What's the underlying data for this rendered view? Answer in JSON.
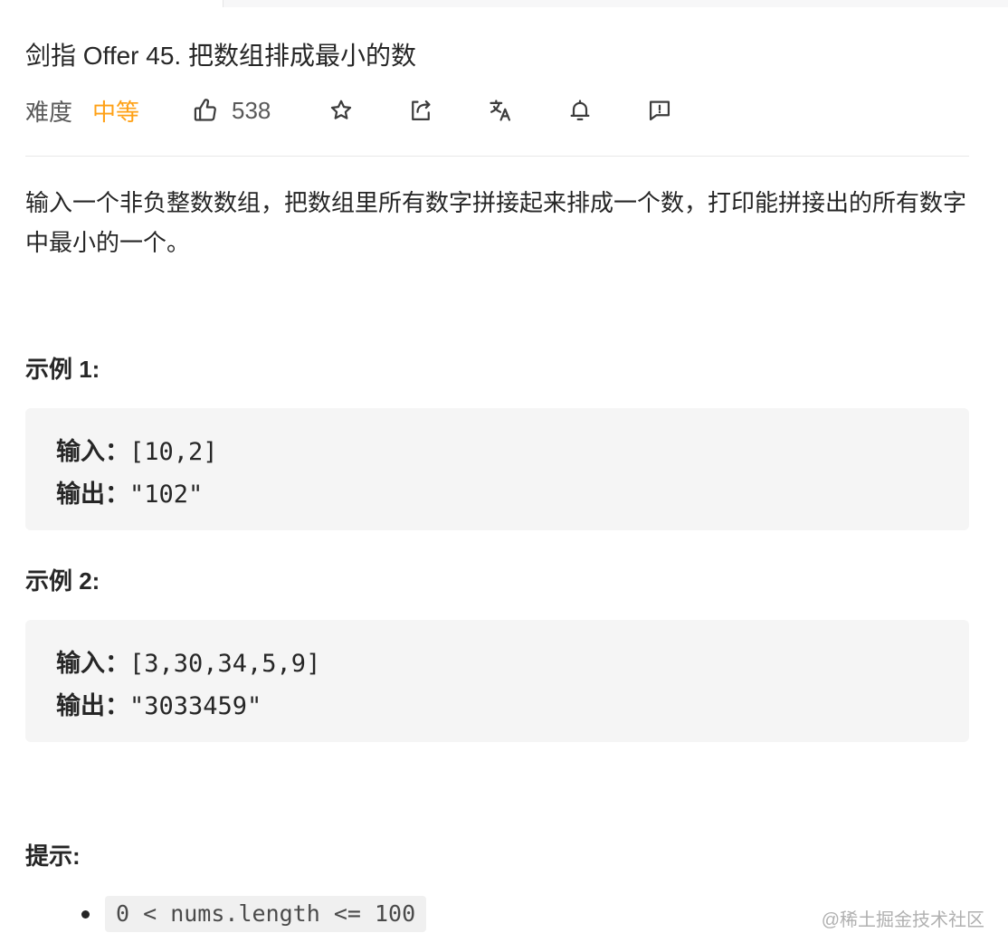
{
  "problem": {
    "title": "剑指 Offer 45. 把数组排成最小的数",
    "difficulty_label": "难度",
    "difficulty_value": "中等",
    "likes": "538",
    "description": "输入一个非负整数数组，把数组里所有数字拼接起来排成一个数，打印能拼接出的所有数字中最小的一个。"
  },
  "toolbar": {
    "icons": [
      "thumbs-up-icon",
      "star-icon",
      "share-icon",
      "translate-icon",
      "bell-icon",
      "feedback-icon"
    ]
  },
  "examples": [
    {
      "heading": "示例 1:",
      "input_label": "输入：",
      "input_value": "[10,2]",
      "output_label": "输出：",
      "output_value": "\"102\""
    },
    {
      "heading": "示例 2:",
      "input_label": "输入：",
      "input_value": "[3,30,34,5,9]",
      "output_label": "输出：",
      "output_value": "\"3033459\""
    }
  ],
  "hints": {
    "heading": "提示:",
    "items": [
      "0 < nums.length <= 100"
    ]
  },
  "watermark": "@稀土掘金技术社区",
  "colors": {
    "difficulty_medium": "#ffa116",
    "code_background": "#f5f5f5"
  }
}
